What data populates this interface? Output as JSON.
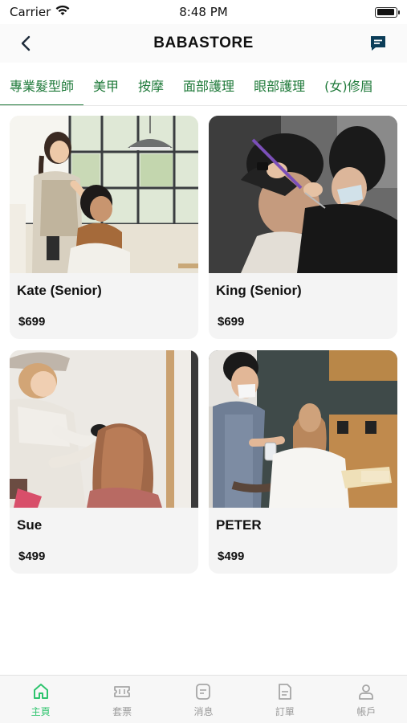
{
  "status_bar": {
    "carrier": "Carrier",
    "time": "8:48 PM",
    "battery_level": 0.95
  },
  "nav": {
    "title": "BABASTORE",
    "back_icon": "chevron-left-icon",
    "chat_icon": "message-square-icon"
  },
  "categories": [
    {
      "label": "專業髮型師",
      "active": true
    },
    {
      "label": "美甲"
    },
    {
      "label": "按摩"
    },
    {
      "label": "面部護理"
    },
    {
      "label": "眼部護理"
    },
    {
      "label": "(女)修眉"
    }
  ],
  "stylists": [
    {
      "name": "Kate (Senior)",
      "price": "$699"
    },
    {
      "name": "King (Senior)",
      "price": "$699"
    },
    {
      "name": "Sue",
      "price": "$499"
    },
    {
      "name": "PETER",
      "price": "$499"
    }
  ],
  "tab_bar": [
    {
      "label": "主頁",
      "icon": "home-icon",
      "active": true
    },
    {
      "label": "套票",
      "icon": "ticket-icon"
    },
    {
      "label": "消息",
      "icon": "message-icon"
    },
    {
      "label": "訂單",
      "icon": "document-icon"
    },
    {
      "label": "帳戶",
      "icon": "user-icon"
    }
  ],
  "colors": {
    "accent": "#1f7a3a",
    "tab_active": "#2fc46e",
    "chat_icon": "#0b3d58"
  }
}
